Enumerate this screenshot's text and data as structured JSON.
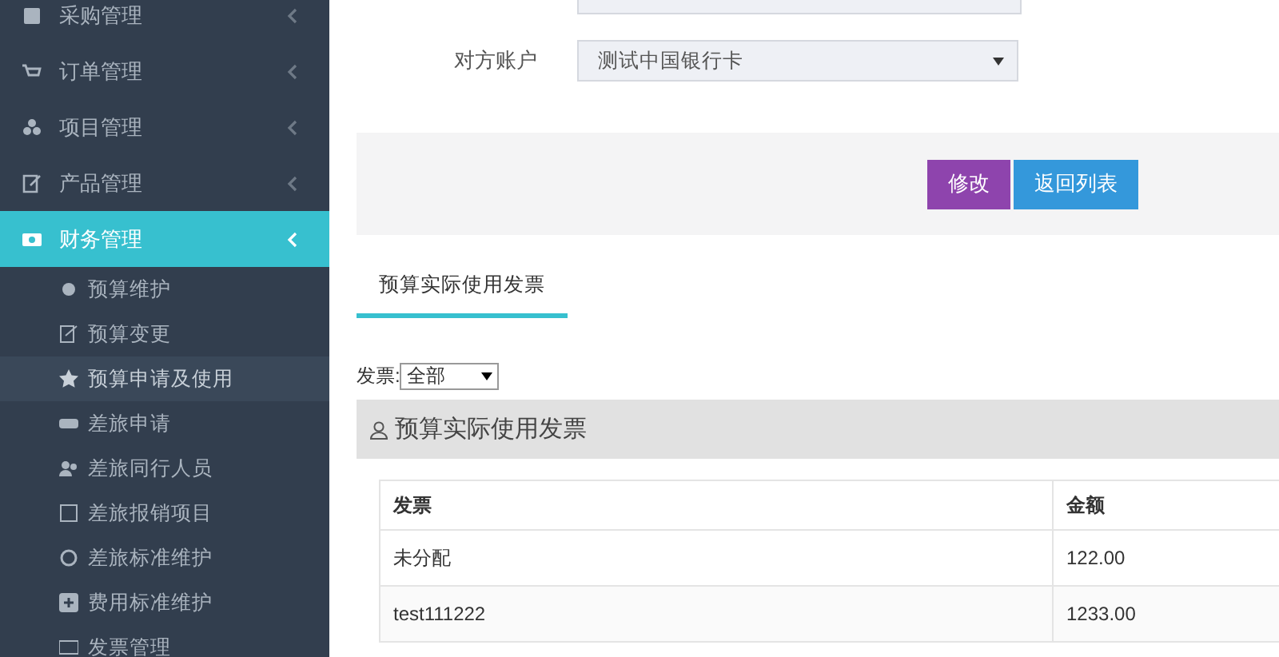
{
  "sidebar": {
    "items": [
      {
        "label": "采购管理",
        "selected": false,
        "expanded": false
      },
      {
        "label": "订单管理",
        "selected": false,
        "expanded": false
      },
      {
        "label": "项目管理",
        "selected": false,
        "expanded": false
      },
      {
        "label": "产品管理",
        "selected": false,
        "expanded": false
      },
      {
        "label": "财务管理",
        "selected": true,
        "expanded": true,
        "children": [
          {
            "label": "预算维护",
            "selected": false
          },
          {
            "label": "预算变更",
            "selected": false
          },
          {
            "label": "预算申请及使用",
            "selected": true
          },
          {
            "label": "差旅申请",
            "selected": false
          },
          {
            "label": "差旅同行人员",
            "selected": false
          },
          {
            "label": "差旅报销项目",
            "selected": false
          },
          {
            "label": "差旅标准维护",
            "selected": false
          },
          {
            "label": "费用标准维护",
            "selected": false
          },
          {
            "label": "发票管理",
            "selected": false
          }
        ]
      }
    ]
  },
  "form": {
    "fields": [
      {
        "label": "对方账户",
        "value": "测试中国银行卡"
      }
    ]
  },
  "buttons": [
    {
      "label": "修改",
      "kind": "edit"
    },
    {
      "label": "返回列表",
      "kind": "back"
    }
  ],
  "tabs": [
    {
      "label": "预算实际使用发票",
      "selected": true
    }
  ],
  "filter": {
    "label": "发票:",
    "value": "全部"
  },
  "panel": {
    "title": "预算实际使用发票"
  },
  "table": {
    "columns": [
      "发票",
      "金额"
    ],
    "rows": [
      [
        "未分配",
        "122.00"
      ],
      [
        "test111222",
        "1233.00"
      ]
    ]
  }
}
